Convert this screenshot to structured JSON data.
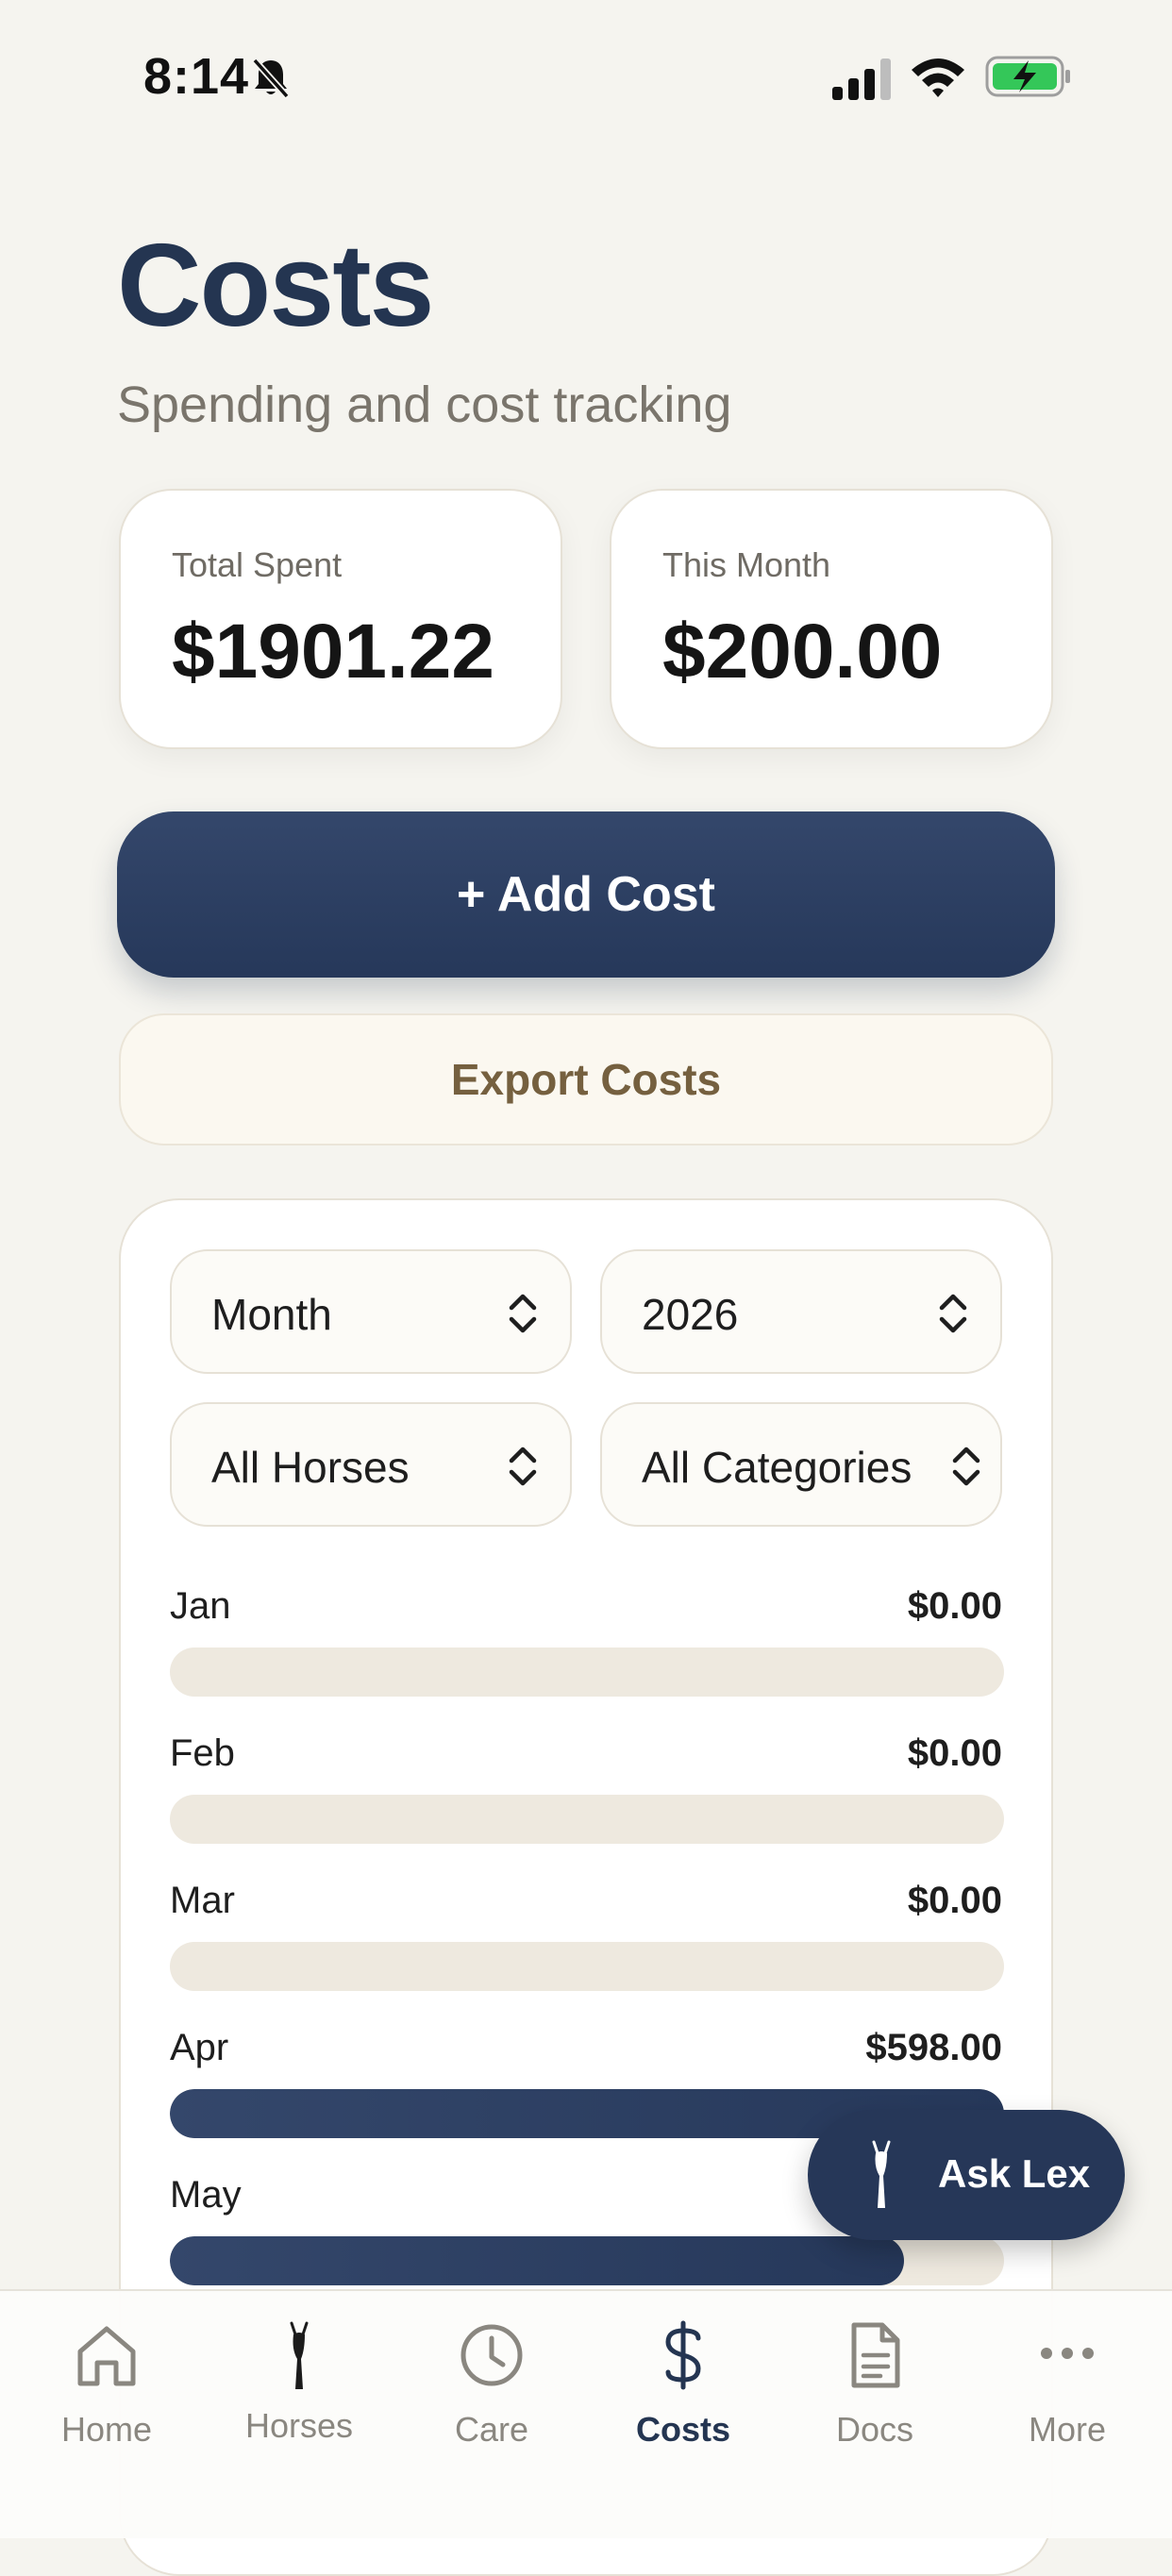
{
  "status_bar": {
    "time": "8:14"
  },
  "header": {
    "title": "Costs",
    "subtitle": "Spending and cost tracking"
  },
  "stats": [
    {
      "label": "Total Spent",
      "value": "$1901.22"
    },
    {
      "label": "This Month",
      "value": "$200.00"
    }
  ],
  "actions": {
    "add_label": "+ Add Cost",
    "export_label": "Export Costs"
  },
  "filters": {
    "period": "Month",
    "year": "2026",
    "horse": "All Horses",
    "category": "All Categories"
  },
  "months": [
    {
      "label": "Jan",
      "amount": "$0.00",
      "fraction": 0
    },
    {
      "label": "Feb",
      "amount": "$0.00",
      "fraction": 0
    },
    {
      "label": "Mar",
      "amount": "$0.00",
      "fraction": 0
    },
    {
      "label": "Apr",
      "amount": "$598.00",
      "fraction": 1.0
    },
    {
      "label": "May",
      "amount": "",
      "fraction": 0.88
    }
  ],
  "ask_lex": {
    "label": "Ask Lex"
  },
  "tabs": [
    {
      "label": "Home",
      "icon": "home-icon",
      "active": false
    },
    {
      "label": "Horses",
      "icon": "horse-icon",
      "active": false
    },
    {
      "label": "Care",
      "icon": "clock-icon",
      "active": false
    },
    {
      "label": "Costs",
      "icon": "dollar-icon",
      "active": true
    },
    {
      "label": "Docs",
      "icon": "document-icon",
      "active": false
    },
    {
      "label": "More",
      "icon": "more-icon",
      "active": false
    }
  ],
  "colors": {
    "primary": "#243551",
    "background": "#f5f4ef",
    "bar_track": "#eee9df",
    "export_text": "#75603f",
    "battery_green": "#34c759"
  }
}
